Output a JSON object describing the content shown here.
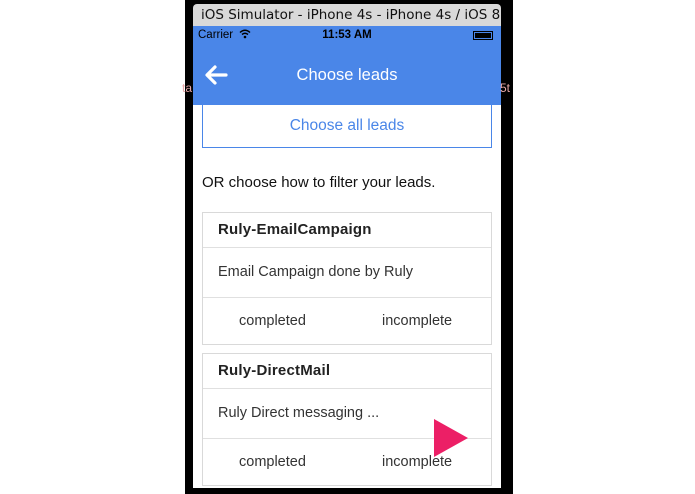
{
  "window": {
    "title": "iOS Simulator - iPhone 4s - iPhone 4s / iOS 8..."
  },
  "statusbar": {
    "carrier": "Carrier",
    "time": "11:53 AM"
  },
  "navbar": {
    "title": "Choose leads"
  },
  "ghost": {
    "left": "ta",
    "right": "5t"
  },
  "main": {
    "choose_all_label": "Choose all leads",
    "filter_text": "OR choose how to filter your leads."
  },
  "cards": [
    {
      "title": "Ruly-EmailCampaign",
      "description": "Email Campaign done by Ruly",
      "action_left": "completed",
      "action_right": "incomplete"
    },
    {
      "title": "Ruly-DirectMail",
      "description": "Ruly Direct messaging ...",
      "action_left": "completed",
      "action_right": "incomplete"
    }
  ],
  "colors": {
    "primary": "#4a86e8",
    "play": "#ec1f66",
    "frame": "#000000"
  },
  "icons": {
    "back": "back-arrow-icon",
    "wifi": "wifi-icon",
    "battery": "battery-icon",
    "play": "play-icon"
  }
}
